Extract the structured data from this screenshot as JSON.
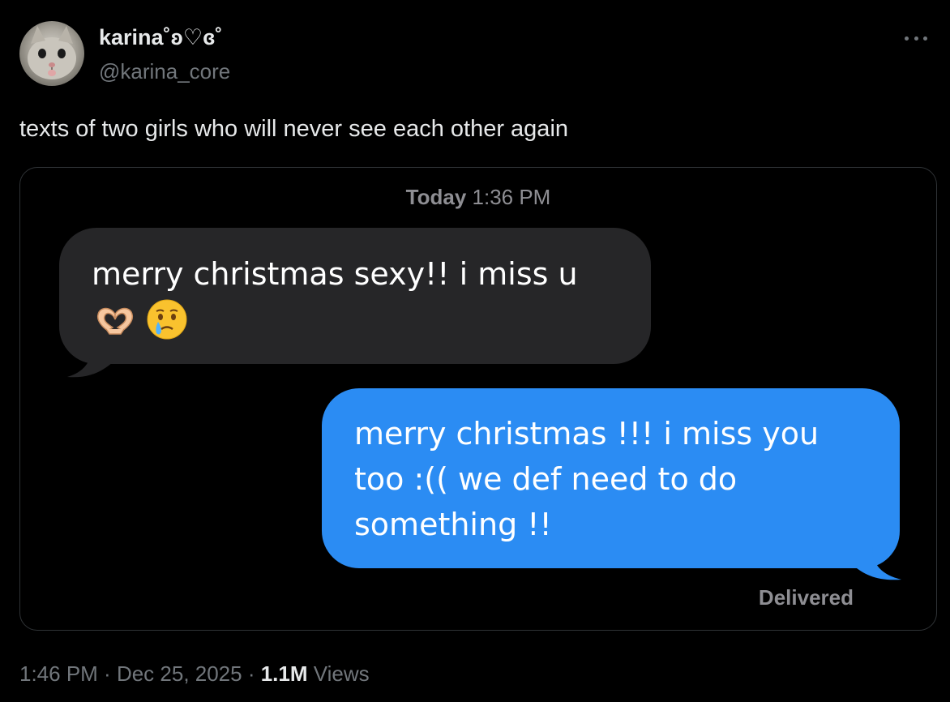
{
  "author": {
    "display_name": "karina˚ʚ♡ɞ˚",
    "handle": "@karina_core",
    "avatar_icon": "cat-photo-avatar"
  },
  "more_icon": "ellipsis-icon",
  "tweet": {
    "text": "texts of two girls who will never see each other again"
  },
  "screenshot": {
    "timestamp_day": "Today",
    "timestamp_time": "1:36 PM",
    "received_message": {
      "text": "merry christmas sexy!! i miss u",
      "emojis": [
        "heart-hands-emoji",
        "face-holding-back-tears-emoji"
      ]
    },
    "sent_message": {
      "text": "merry christmas !!! i miss you too :(( we def need to do something !!"
    },
    "status": "Delivered",
    "colors": {
      "received_bubble": "#262628",
      "sent_bubble": "#2b8cf3"
    }
  },
  "meta": {
    "time": "1:46 PM",
    "separator": " · ",
    "date": "Dec 25, 2025",
    "views_count": "1.1M",
    "views_label": "Views"
  }
}
